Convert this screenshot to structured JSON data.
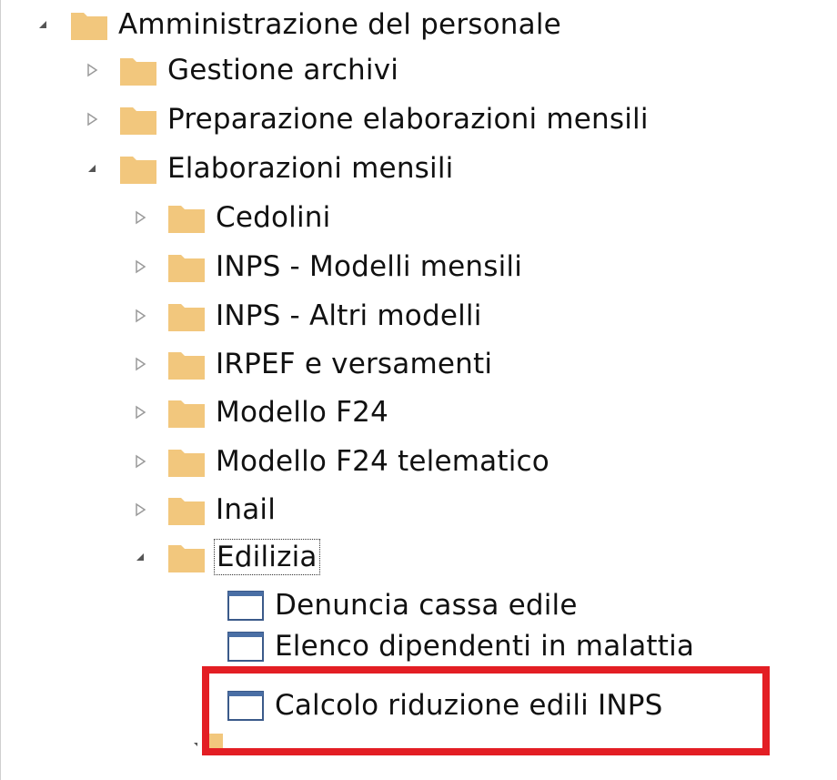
{
  "tree": {
    "root": {
      "label": "Amministrazione del personale",
      "expanded": true,
      "icon": "folder-icon"
    },
    "level1": [
      {
        "label": "Gestione archivi",
        "expanded": false
      },
      {
        "label": "Preparazione elaborazioni mensili",
        "expanded": false
      },
      {
        "label": "Elaborazioni mensili",
        "expanded": true
      }
    ],
    "level2": [
      {
        "label": "Cedolini",
        "expanded": false
      },
      {
        "label": "INPS - Modelli mensili",
        "expanded": false
      },
      {
        "label": "INPS - Altri modelli",
        "expanded": false
      },
      {
        "label": "IRPEF e versamenti",
        "expanded": false
      },
      {
        "label": "Modello F24",
        "expanded": false
      },
      {
        "label": "Modello F24 telematico",
        "expanded": false
      },
      {
        "label": "Inail",
        "expanded": false
      },
      {
        "label": "Edilizia",
        "expanded": true,
        "focused": true
      }
    ],
    "level3": [
      {
        "label": "Denuncia cassa edile"
      },
      {
        "label": "Elenco dipendenti in malattia"
      },
      {
        "label": "Calcolo riduzione edili INPS",
        "highlighted": true
      }
    ]
  },
  "colors": {
    "folder": "#f2c77d",
    "doc_header": "#4a6fa5",
    "highlight_border": "#e31e24",
    "arrow": "#9a9a9a"
  }
}
